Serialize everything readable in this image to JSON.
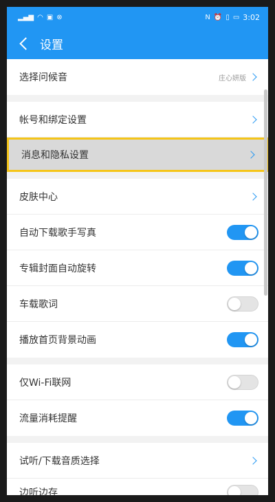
{
  "status_bar": {
    "left_icons": [
      "signal-icon",
      "wifi-icon",
      "data-icon",
      "nfc-icon"
    ],
    "right_icons": [
      "nfc-icon",
      "alarm-icon",
      "vibrate-icon",
      "battery-icon"
    ],
    "time": "3:02"
  },
  "header": {
    "title": "设置"
  },
  "groups": [
    {
      "items": [
        {
          "label": "选择问候音",
          "value": "庄心妍版",
          "control": "chevron"
        }
      ]
    },
    {
      "items": [
        {
          "label": "帐号和绑定设置",
          "control": "chevron"
        },
        {
          "label": "消息和隐私设置",
          "control": "chevron",
          "highlighted": true
        }
      ]
    },
    {
      "items": [
        {
          "label": "皮肤中心",
          "control": "chevron"
        },
        {
          "label": "自动下载歌手写真",
          "control": "toggle",
          "on": true
        },
        {
          "label": "专辑封面自动旋转",
          "control": "toggle",
          "on": true
        },
        {
          "label": "车载歌词",
          "control": "toggle",
          "on": false
        },
        {
          "label": "播放首页背景动画",
          "control": "toggle",
          "on": true
        }
      ]
    },
    {
      "items": [
        {
          "label": "仅Wi-Fi联网",
          "control": "toggle",
          "on": false
        },
        {
          "label": "流量消耗提醒",
          "control": "toggle",
          "on": true
        }
      ]
    },
    {
      "items": [
        {
          "label": "试听/下载音质选择",
          "control": "chevron"
        },
        {
          "label": "边听边存",
          "control": "toggle",
          "on": false,
          "partial": true
        }
      ]
    }
  ],
  "colors": {
    "accent": "#2196f3",
    "highlight_border": "#f5c518"
  }
}
